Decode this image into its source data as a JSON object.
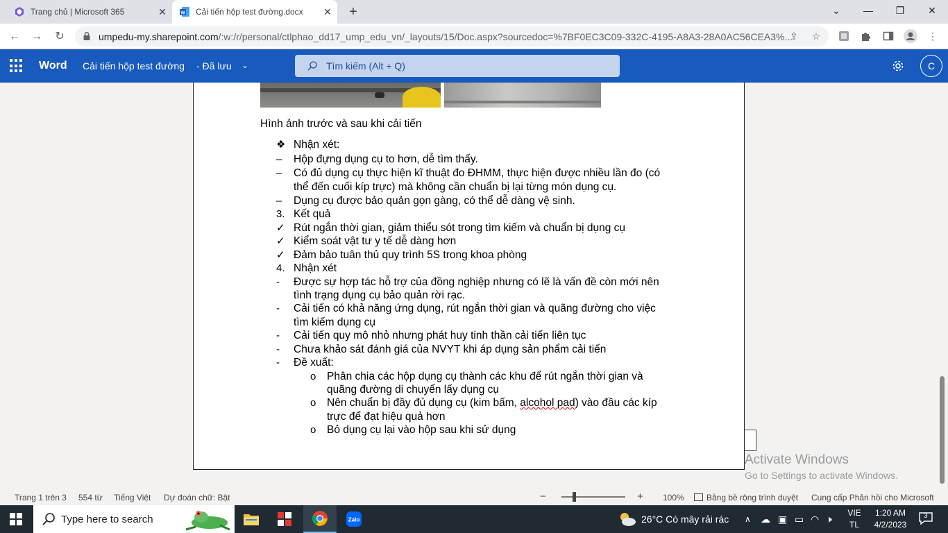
{
  "browser": {
    "tabs": [
      {
        "title": "Trang chủ | Microsoft 365"
      },
      {
        "title": "Cải tiến hộp test đường.docx"
      }
    ],
    "url_host": "umpedu-my.sharepoint.com",
    "url_path": "/:w:/r/personal/ctlphao_dd17_ump_edu_vn/_layouts/15/Doc.aspx?sourcedoc=%7BF0EC3C09-332C-4195-A8A3-28A0AC56CEA3%..."
  },
  "word": {
    "app_name": "Word",
    "doc_title": "Cải tiến hộp test đường",
    "save_status": "-  Đã lưu",
    "search_placeholder": "Tìm kiếm (Alt + Q)",
    "avatar_initial": "C"
  },
  "document": {
    "caption": "Hình ảnh trước và sau khi cải tiến",
    "lines": [
      {
        "bullet": "❖",
        "text": "Nhận xét:"
      },
      {
        "bullet": "–",
        "text": "Hộp đựng dụng cụ to hơn, dễ tìm thấy."
      },
      {
        "bullet": "–",
        "text": "Có đủ dụng cụ thực hiện kĩ thuật đo ĐHMM, thực hiện được nhiều lần đo (có"
      },
      {
        "bullet": "",
        "text": "thể đến cuối kíp trực) mà không cần chuẩn bị lại từng món dụng cụ."
      },
      {
        "bullet": "–",
        "text": "Dụng cụ được bảo quản gọn gàng, có thể dễ dàng vệ sinh."
      },
      {
        "bullet": "3.",
        "text": "Kết quả"
      },
      {
        "bullet": "✓",
        "text": "Rút ngắn thời gian, giảm thiểu sót trong tìm kiếm và chuẩn bị dụng cụ"
      },
      {
        "bullet": "✓",
        "text": "Kiểm soát vật tư y tế dễ dàng hơn"
      },
      {
        "bullet": "✓",
        "text": "Đảm bảo tuân thủ quy trình 5S trong khoa phòng"
      },
      {
        "bullet": "4.",
        "text": "Nhận xét"
      },
      {
        "bullet": "-",
        "text": "Được sự hợp tác hỗ trợ của đồng nghiệp nhưng có lẽ là vấn đề còn mới nên"
      },
      {
        "bullet": "",
        "text": "tình trạng dụng cụ bảo quản rời rạc."
      },
      {
        "bullet": "-",
        "text": "Cải tiến có khả năng ứng dụng, rút ngắn thời gian và quãng đường cho việc"
      },
      {
        "bullet": "",
        "text": "tìm kiếm dụng cụ"
      },
      {
        "bullet": "-",
        "text": "Cải tiến quy mô nhỏ nhưng phát huy tinh thần cải tiến liên tục"
      },
      {
        "bullet": "-",
        "text": "Chưa khảo sát đánh giá của NVYT khi áp dụng sản phẩm cải tiến"
      },
      {
        "bullet": "-",
        "text": "Đề xuất:"
      }
    ],
    "subitems": [
      {
        "bullet": "o",
        "text": "Phân chia các hộp dụng cụ thành các khu để rút ngắn thời gian và"
      },
      {
        "bullet": "",
        "text": "quãng đường di chuyển lấy dụng cụ"
      },
      {
        "bullet": "o",
        "text_before": "Nên chuẩn bị đầy đủ dụng cụ (kim bấm, ",
        "text_wavy": "alcohol pad",
        "text_after": ") vào đầu các kíp"
      },
      {
        "bullet": "",
        "text": "trực để đạt hiệu quả hơn"
      },
      {
        "bullet": "o",
        "text": "Bỏ dụng cụ lại vào hộp sau khi sử dụng"
      }
    ]
  },
  "watermark": {
    "line1": "Activate Windows",
    "line2": "Go to Settings to activate Windows."
  },
  "statusbar": {
    "page": "Trang 1 trên 3",
    "words": "554 từ",
    "language": "Tiếng Việt",
    "predict": "Dự đoán chữ: Bật",
    "zoom_minus": "−",
    "zoom_plus": "+",
    "zoom": "100%",
    "view": "Bằng bề rộng trình duyệt",
    "feedback": "Cung cấp Phản hồi cho Microsoft"
  },
  "taskbar": {
    "search_placeholder": "Type here to search",
    "weather": "26°C  Có mây rải rác",
    "ime_line1": "VIE",
    "ime_line2": "TL",
    "time": "1:20 AM",
    "date": "4/2/2023",
    "notifications": "3"
  }
}
